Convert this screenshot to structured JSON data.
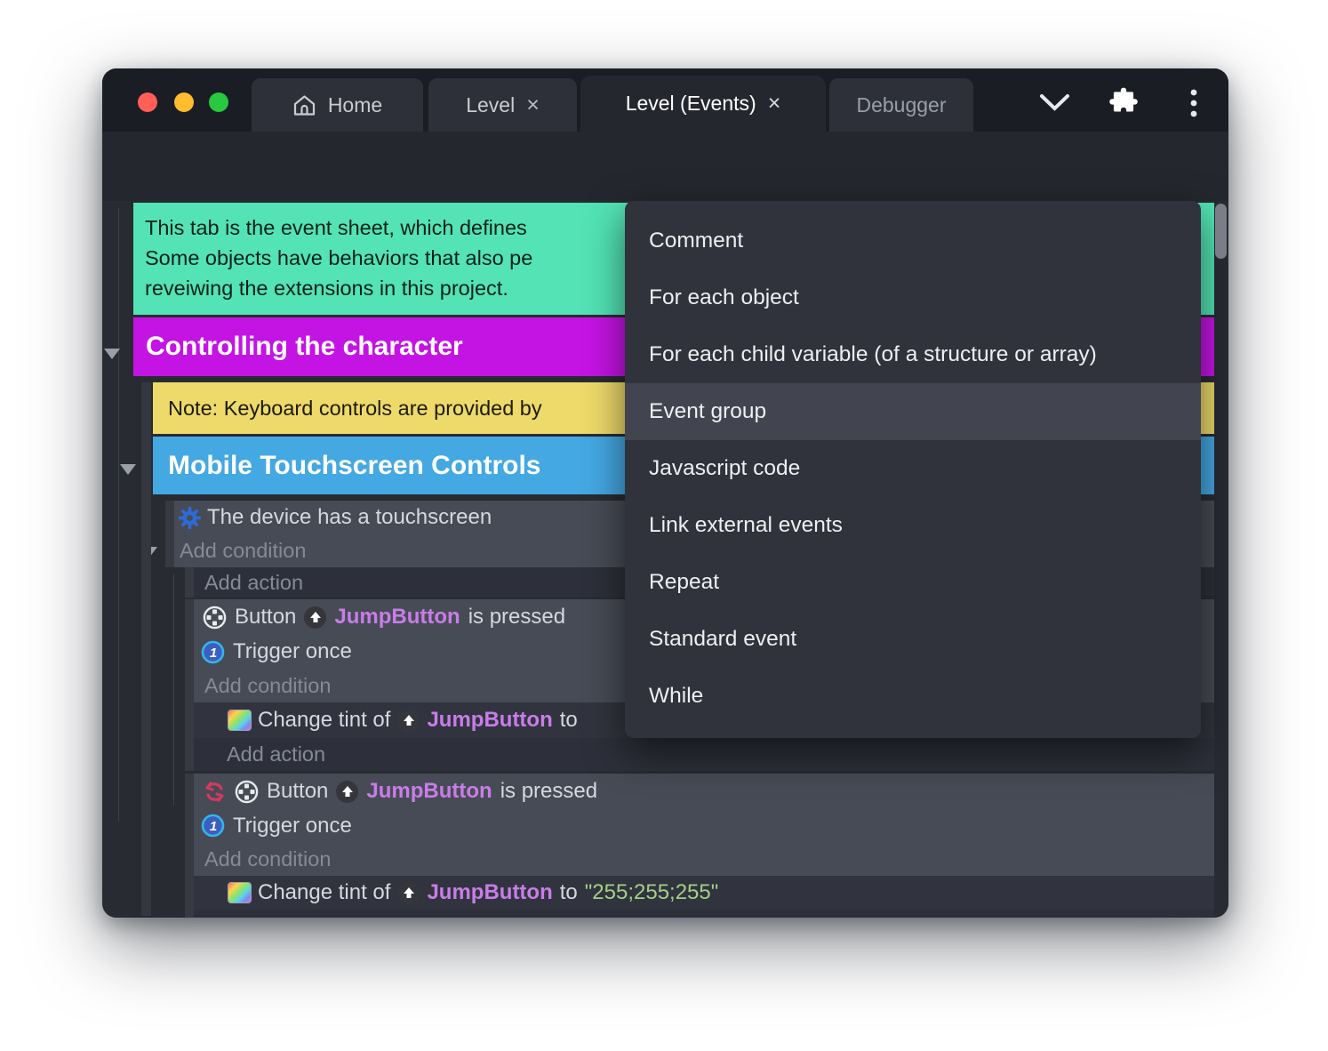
{
  "window": {
    "traffic_lights": [
      "close",
      "minimize",
      "zoom"
    ],
    "tabs": [
      {
        "label": "Home",
        "icon": "home-icon"
      },
      {
        "label": "Level",
        "close": "×"
      },
      {
        "label": "Level (Events)",
        "close": "×",
        "active": true
      },
      {
        "label": "Debugger"
      }
    ],
    "titlebar_icons": [
      "chevron-down",
      "extensions-puzzle",
      "overflow-menu"
    ]
  },
  "toolbar": {
    "icons": [
      "layout",
      "save",
      "play",
      "play-dropdown",
      "preview-globe",
      "add-event",
      "add-sub-event",
      "add-comment",
      "add-circle",
      "delete",
      "undo",
      "redo",
      "search"
    ],
    "accent_color": "#5a35d9"
  },
  "menu": {
    "items": [
      {
        "label": "Comment"
      },
      {
        "label": "For each object"
      },
      {
        "label": "For each child variable (of a structure or array)"
      },
      {
        "label": "Event group",
        "highlighted": true
      },
      {
        "label": "Javascript code"
      },
      {
        "label": "Link external events"
      },
      {
        "label": "Repeat"
      },
      {
        "label": "Standard event"
      },
      {
        "label": "While"
      }
    ],
    "highlight_color": "#42444f"
  },
  "sheet": {
    "comment_lines": [
      "This tab is the event sheet, which defines",
      "Some objects have behaviors that also pe",
      "reveiwing the extensions in this project."
    ],
    "group_controlling": "Controlling the character",
    "note": "Note: Keyboard controls are provided by",
    "group_mobile": "Mobile Touchscreen Controls",
    "device_condition": "The device has a touchscreen",
    "add_condition": "Add condition",
    "add_action": "Add action",
    "event1": {
      "object": "Button",
      "instance": "JumpButton",
      "condition_suffix": "is pressed",
      "trigger": "Trigger once",
      "action_prefix": "Change tint of",
      "action_suffix": "to"
    },
    "event2": {
      "inverted": true,
      "object": "Button",
      "instance": "JumpButton",
      "condition_suffix": "is pressed",
      "trigger": "Trigger once",
      "action_prefix": "Change tint of",
      "action_suffix": "to",
      "action_value": "\"255;255;255\""
    },
    "colors": {
      "comment_bg": "#53e3b5",
      "group_controlling_bg": "#c414e4",
      "note_bg": "#eed96b",
      "group_mobile_bg": "#44a8e2",
      "block_bg": "#474b55",
      "action_row_bg": "#31343e",
      "add_action_row_bg": "#2d303a",
      "instance_text": "#c87de8",
      "string_text": "#a3cf87"
    }
  }
}
